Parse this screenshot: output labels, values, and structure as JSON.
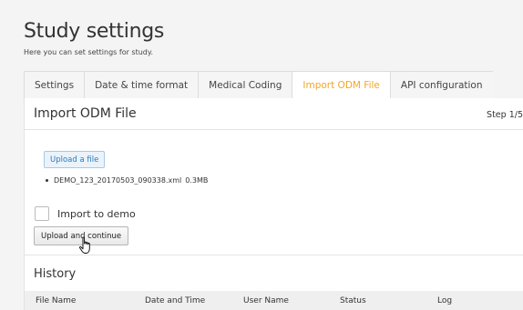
{
  "page": {
    "title": "Study settings",
    "subtitle": "Here you can set settings for study."
  },
  "tabs": [
    {
      "label": "Settings"
    },
    {
      "label": "Date & time format"
    },
    {
      "label": "Medical Coding"
    },
    {
      "label": "Import ODM File",
      "active": true
    },
    {
      "label": "API configuration"
    }
  ],
  "import_panel": {
    "title": "Import ODM File",
    "step": "Step 1/5",
    "upload_button": "Upload a file",
    "file": {
      "name": "DEMO_123_20170503_090338.xml",
      "size": "0.3MB"
    },
    "import_to_demo": {
      "label": "Import to demo",
      "checked": false
    },
    "continue_button": "Upload and continue"
  },
  "history": {
    "title": "History",
    "columns": [
      "File Name",
      "Date and Time",
      "User Name",
      "Status",
      "Log"
    ]
  },
  "colors": {
    "active_tab": "#f5a623",
    "link_blue": "#2b7bbf",
    "background": "#f4f4f4"
  },
  "icons": {
    "cursor": "hand-pointer-icon"
  }
}
